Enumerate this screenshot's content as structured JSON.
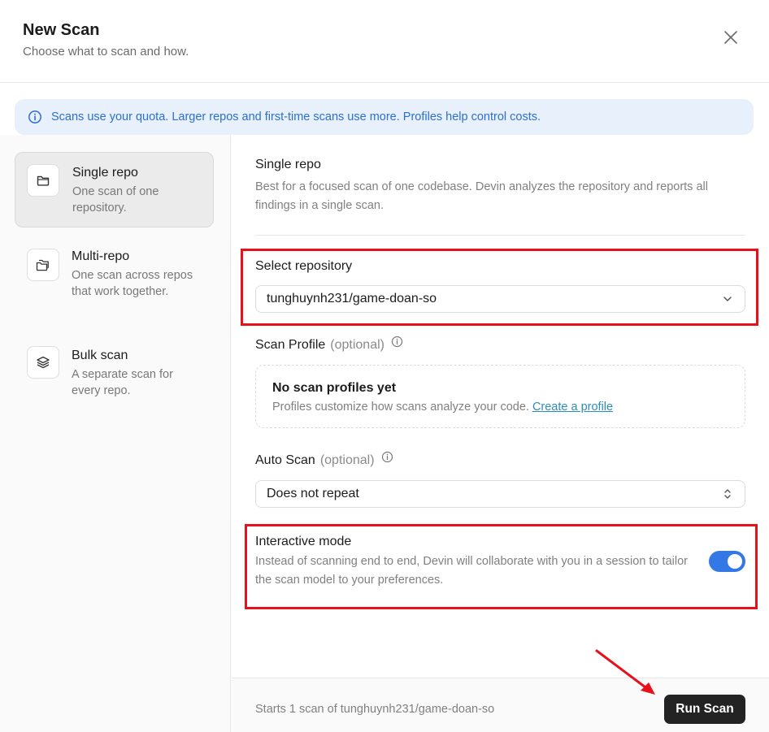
{
  "dialog": {
    "title": "New Scan",
    "subtitle": "Choose what to scan and how."
  },
  "banner": {
    "text": "Scans use your quota. Larger repos and first-time scans use more. Profiles help control costs."
  },
  "modes": [
    {
      "label": "Single repo",
      "description": "One scan of one repository.",
      "icon": "folder-icon",
      "selected": true
    },
    {
      "label": "Multi-repo",
      "description": "One scan across repos that work together.",
      "icon": "folders-icon",
      "selected": false
    },
    {
      "label": "Bulk scan",
      "description": "A separate scan for every repo.",
      "icon": "layers-icon",
      "selected": false
    }
  ],
  "section": {
    "title": "Single repo",
    "description": "Best for a focused scan of one codebase. Devin analyzes the repository and reports all findings in a single scan."
  },
  "repository": {
    "label": "Select repository",
    "value": "tunghuynh231/game-doan-so"
  },
  "scan_profile": {
    "label": "Scan Profile",
    "optional": "(optional)",
    "empty_title": "No scan profiles yet",
    "empty_text": "Profiles customize how scans analyze your code.",
    "create_link": "Create a profile"
  },
  "auto_scan": {
    "label": "Auto Scan",
    "optional": "(optional)",
    "value": "Does not repeat"
  },
  "interactive": {
    "title": "Interactive mode",
    "description": "Instead of scanning end to end, Devin will collaborate with you in a session to tailor the scan model to your preferences.",
    "enabled": true
  },
  "footer": {
    "summary": "Starts 1 scan of tunghuynh231/game-doan-so",
    "run_label": "Run Scan"
  },
  "colors": {
    "accent": "#3478e5",
    "banner_text": "#2c6fd0",
    "banner_bg": "#e8f0fb",
    "highlight": "#e8111b",
    "link": "#2a8ec0",
    "run_button": "#232323"
  }
}
